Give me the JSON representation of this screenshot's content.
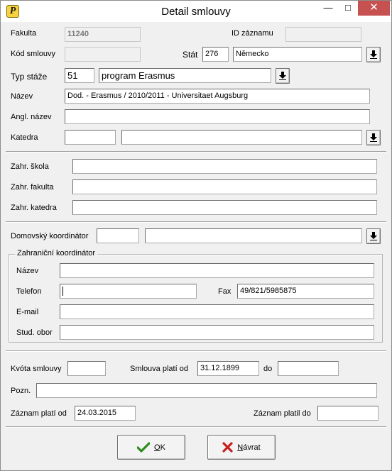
{
  "window": {
    "title": "Detail smlouvy",
    "minimize_glyph": "—",
    "maximize_glyph": "□",
    "close_glyph": "✕"
  },
  "colors": {
    "close_button": "#c75050",
    "ok_icon": "#2e8b1e",
    "cancel_icon": "#c8201e"
  },
  "icons": {
    "app": "app-p-icon",
    "dropdown": "dropdown-arrow-icon",
    "ok": "check-icon",
    "cancel": "x-icon"
  },
  "main": {
    "fakulta": {
      "label": "Fakulta",
      "value": "11240"
    },
    "id_zaznamu": {
      "label": "ID záznamu",
      "value": ""
    },
    "kod_smlouvy": {
      "label": "Kód smlouvy",
      "value": ""
    },
    "stat": {
      "label": "Stát",
      "code": "276",
      "name": "Německo"
    },
    "typ_staze": {
      "label": "Typ stáže",
      "code": "51",
      "name": "program Erasmus"
    },
    "nazev": {
      "label": "Název",
      "value": "Dod. - Erasmus / 2010/2011 - Universitaet Augsburg"
    },
    "angl_nazev": {
      "label": "Angl. název",
      "value": ""
    },
    "katedra": {
      "label": "Katedra",
      "code": "",
      "name": ""
    }
  },
  "foreign": {
    "skola": {
      "label": "Zahr. škola",
      "value": ""
    },
    "fakulta": {
      "label": "Zahr. fakulta",
      "value": ""
    },
    "katedra": {
      "label": "Zahr. katedra",
      "value": ""
    }
  },
  "coordinators": {
    "domestic": {
      "label": "Domovský koordinátor",
      "code": "",
      "name": ""
    },
    "foreign": {
      "title": "Zahraniční koordinátor",
      "nazev": {
        "label": "Název",
        "value": ""
      },
      "telefon": {
        "label": "Telefon",
        "value": ""
      },
      "fax": {
        "label": "Fax",
        "value": "49/821/5985875"
      },
      "email": {
        "label": "E-mail",
        "value": ""
      },
      "stud_obor": {
        "label": "Stud. obor",
        "value": ""
      }
    }
  },
  "validity": {
    "kvota": {
      "label": "Kvóta smlouvy",
      "value": ""
    },
    "smlouva_od": {
      "label": "Smlouva platí od",
      "value": "31.12.1899"
    },
    "do": {
      "label": "do",
      "value": ""
    },
    "pozn": {
      "label": "Pozn.",
      "value": ""
    },
    "zaznam_od": {
      "label": "Záznam platí od",
      "value": "24.03.2015"
    },
    "zaznam_do": {
      "label": "Záznam platil do",
      "value": ""
    }
  },
  "buttons": {
    "ok": {
      "mnemonic": "O",
      "rest": "K"
    },
    "cancel": {
      "mnemonic": "N",
      "rest": "ávrat"
    }
  }
}
